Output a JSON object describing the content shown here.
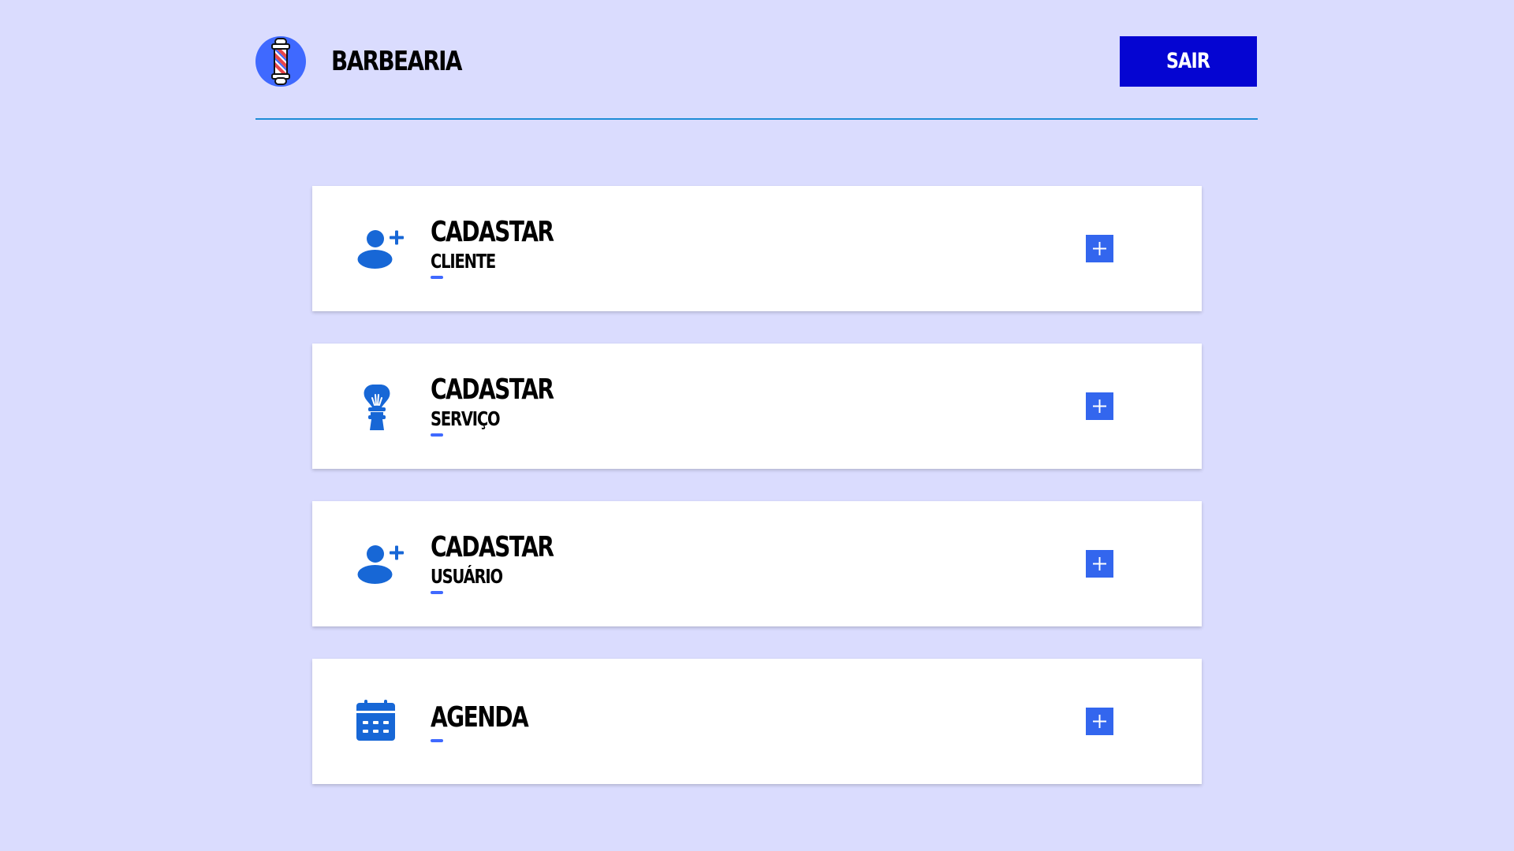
{
  "header": {
    "brand": "BARBEARIA",
    "logout_label": "SAIR"
  },
  "cards": [
    {
      "title": "CADASTAR",
      "subtitle": "CLIENTE",
      "icon": "add-user-icon"
    },
    {
      "title": "CADASTAR",
      "subtitle": "SERVIÇO",
      "icon": "shaving-brush-icon"
    },
    {
      "title": "CADASTAR",
      "subtitle": "USUÁRIO",
      "icon": "add-user-icon"
    },
    {
      "title": "AGENDA",
      "subtitle": "",
      "icon": "calendar-icon"
    }
  ],
  "colors": {
    "background": "#dadcfe",
    "accent": "#3f69ff",
    "logout_button": "#0505d2",
    "icon": "#1767d6",
    "divider": "#1e8cd6"
  }
}
